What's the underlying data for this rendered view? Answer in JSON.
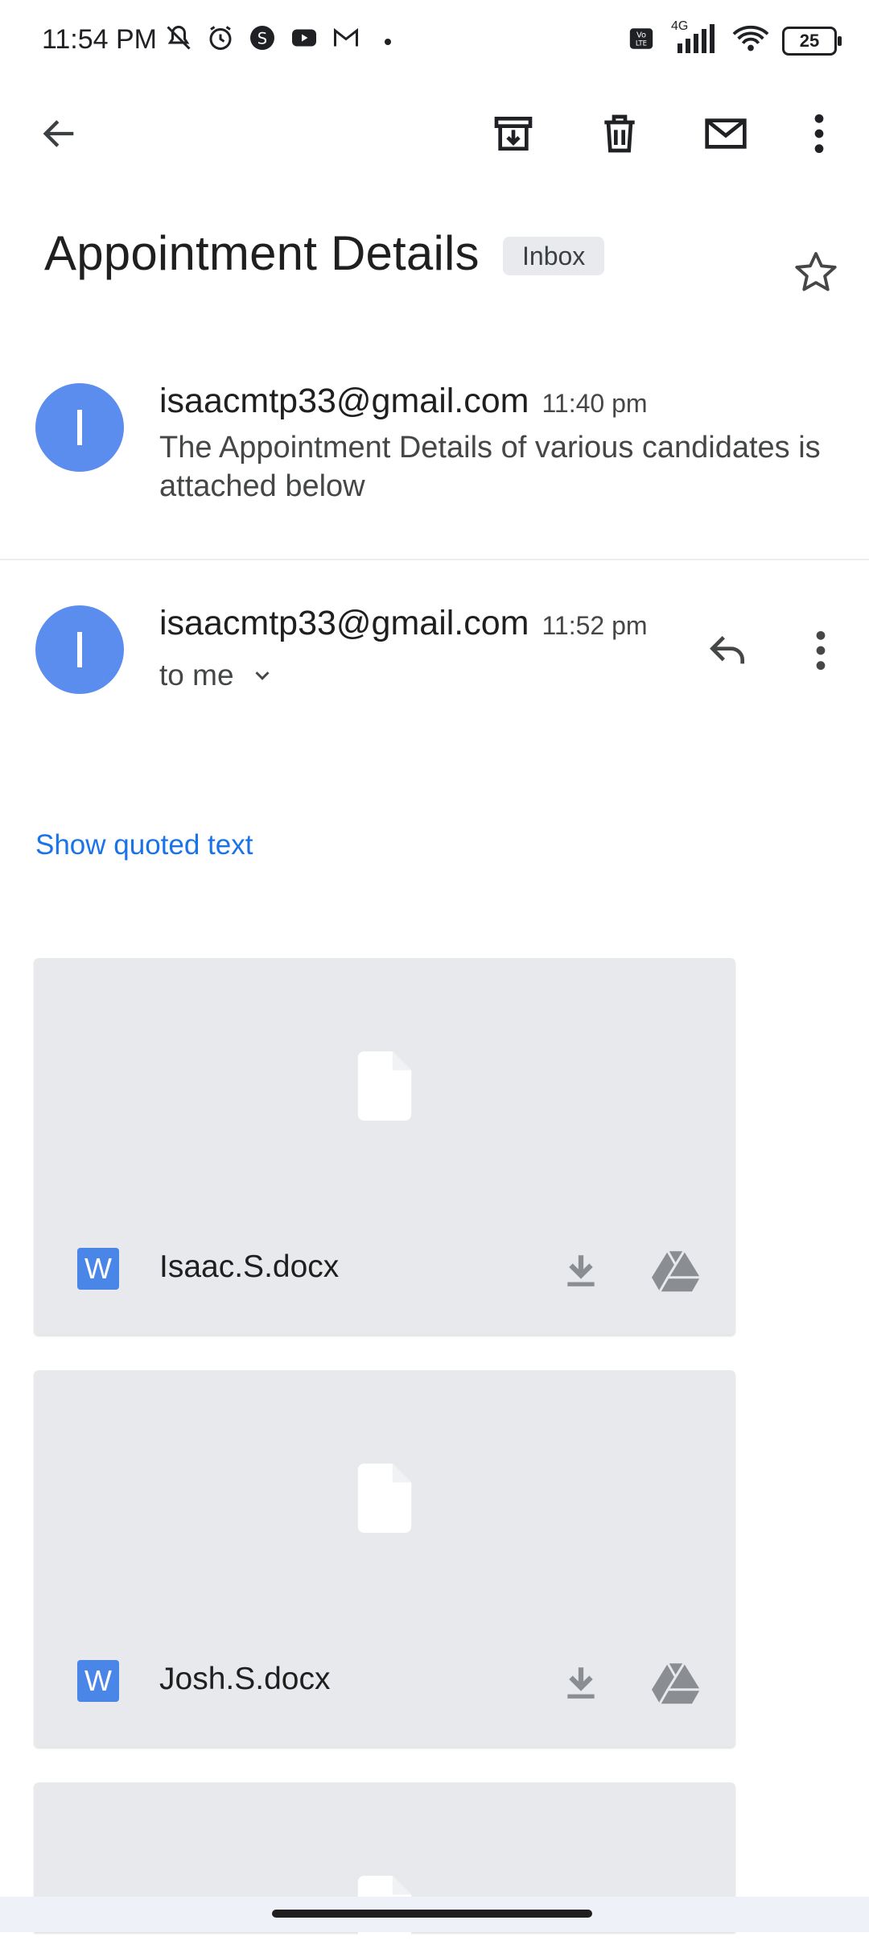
{
  "status_bar": {
    "time": "11:54 PM",
    "battery": "25",
    "network": "4G",
    "left_icons": [
      "mute-icon",
      "alarm-icon",
      "s-app-icon",
      "youtube-icon",
      "gmail-icon"
    ],
    "right_icons": [
      "volte-icon",
      "signal-icon",
      "wifi-icon",
      "battery-icon"
    ]
  },
  "toolbar": {
    "icons": [
      "back-icon",
      "archive-icon",
      "delete-icon",
      "mark-unread-icon",
      "more-vert-icon"
    ]
  },
  "email": {
    "subject": "Appointment Details",
    "label": "Inbox",
    "messages": [
      {
        "avatar_letter": "I",
        "sender": "isaacmtp33@gmail.com",
        "time": "11:40 pm",
        "snippet": "The Appointment Details of various candidates is attached below"
      },
      {
        "avatar_letter": "I",
        "sender": "isaacmtp33@gmail.com",
        "time": "11:52 pm",
        "recipient": "to me",
        "show_quoted": "Show quoted text"
      }
    ],
    "attachments": [
      {
        "badge": "W",
        "filename": "Isaac.S.docx"
      },
      {
        "badge": "W",
        "filename": "Josh.S.docx"
      },
      {
        "badge": "",
        "filename": ""
      }
    ]
  },
  "colors": {
    "accent": "#1a73e8",
    "avatar": "#5b8def",
    "word_badge": "#4a86e8",
    "attachment_bg": "#e8e9ec"
  }
}
